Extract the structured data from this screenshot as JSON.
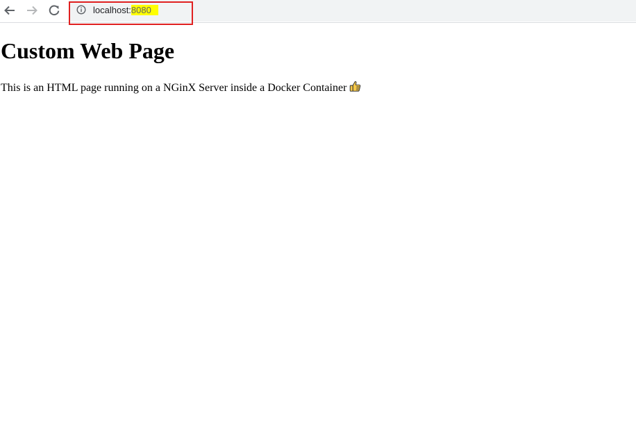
{
  "browser": {
    "url_host": "localhost:",
    "url_port": "8080",
    "icons": {
      "back": "arrow-left-icon",
      "forward": "arrow-right-icon",
      "reload": "reload-icon",
      "info": "info-icon"
    },
    "colors": {
      "port_highlight": "#ffff00",
      "annotation_box": "#e02020"
    }
  },
  "page": {
    "heading": "Custom Web Page",
    "paragraph": "This is an HTML page running on a NGinX Server inside a Docker Container",
    "emoji_icon": "thumbs-up-icon"
  }
}
